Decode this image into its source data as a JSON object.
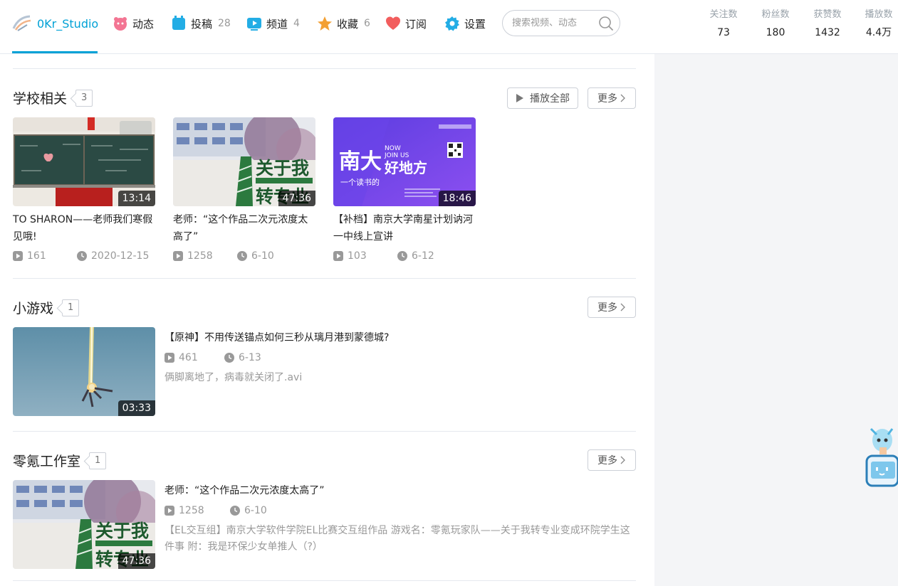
{
  "nav": {
    "username": "0Kr_Studio",
    "items": [
      {
        "label": "动态",
        "count": ""
      },
      {
        "label": "投稿",
        "count": "28"
      },
      {
        "label": "频道",
        "count": "4"
      },
      {
        "label": "收藏",
        "count": "6"
      },
      {
        "label": "订阅",
        "count": ""
      },
      {
        "label": "设置",
        "count": ""
      }
    ],
    "search_placeholder": "搜索视频、动态"
  },
  "stats": [
    {
      "label": "关注数",
      "value": "73"
    },
    {
      "label": "粉丝数",
      "value": "180"
    },
    {
      "label": "获赞数",
      "value": "1432"
    },
    {
      "label": "播放数",
      "value": "4.4万"
    }
  ],
  "sections": [
    {
      "title": "学校相关",
      "count": "3",
      "play_all_label": "播放全部",
      "more_label": "更多",
      "videos": [
        {
          "duration": "13:14",
          "title": "TO SHARON——老师我们寒假见哦!",
          "plays": "161",
          "date": "2020-12-15"
        },
        {
          "duration": "47:36",
          "title": "老师：“这个作品二次元浓度太高了”",
          "plays": "1258",
          "date": "6-10"
        },
        {
          "duration": "18:46",
          "title": "【补档】南京大学南星计划讷河一中线上宣讲",
          "plays": "103",
          "date": "6-12"
        }
      ]
    },
    {
      "title": "小游戏",
      "count": "1",
      "more_label": "更多",
      "video": {
        "duration": "03:33",
        "title": "【原神】不用传送锚点如何三秒从璃月港到蒙德城?",
        "plays": "461",
        "date": "6-13",
        "desc": "俩脚离地了，病毒就关闭了.avi"
      }
    },
    {
      "title": "零氪工作室",
      "count": "1",
      "more_label": "更多",
      "video": {
        "duration": "47:36",
        "title": "老师：“这个作品二次元浓度太高了”",
        "plays": "1258",
        "date": "6-10",
        "desc": "【EL交互组】南京大学软件学院EL比赛交互组作品 游戏名：零氪玩家队——关于我转专业变成环院学生这件事 附：我是环保少女单推人（?）"
      }
    }
  ],
  "thumb_text": {
    "guanyu": "关于我",
    "zhuan": "转专业",
    "nanda": "南大",
    "haodifang": "好地方",
    "yizhi": "一个读书的",
    "now": "NOW",
    "joinus": "JOIN US"
  },
  "colors": {
    "accent": "#00a1d6",
    "right_panel": "#f4f5f7"
  }
}
